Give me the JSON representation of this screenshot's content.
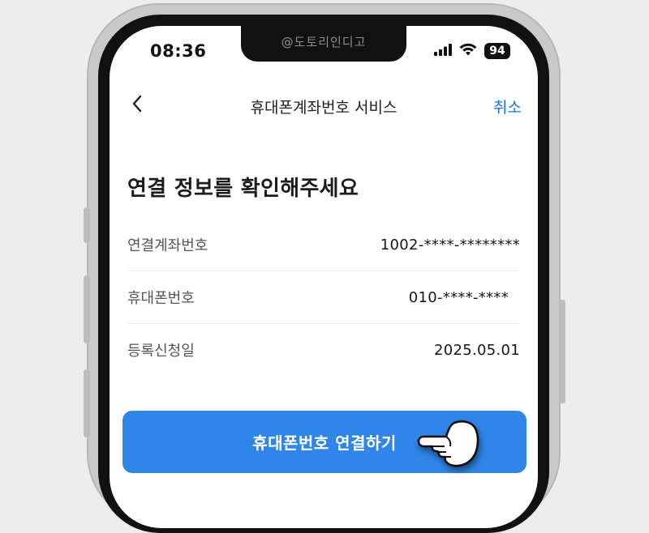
{
  "status_bar": {
    "time": "08:36",
    "battery": "94",
    "icons": [
      "signal-icon",
      "wifi-icon",
      "battery-icon"
    ]
  },
  "watermark": "@도토리인디고",
  "header": {
    "back_icon": "chevron-left-icon",
    "title": "휴대폰계좌번호 서비스",
    "cancel_label": "취소"
  },
  "main": {
    "headline": "연결 정보를 확인해주세요",
    "rows": [
      {
        "label": "연결계좌번호",
        "value": "1002-****-********"
      },
      {
        "label": "휴대폰번호",
        "value": "010-****-****"
      },
      {
        "label": "등록신청일",
        "value": "2025.05.01"
      }
    ]
  },
  "footer": {
    "connect_label": "휴대폰번호 연결하기"
  },
  "colors": {
    "accent": "#1b76dd",
    "button": "#2f86e8",
    "text": "#1c1c1c"
  },
  "pointer_icon": "pointing-hand-icon"
}
